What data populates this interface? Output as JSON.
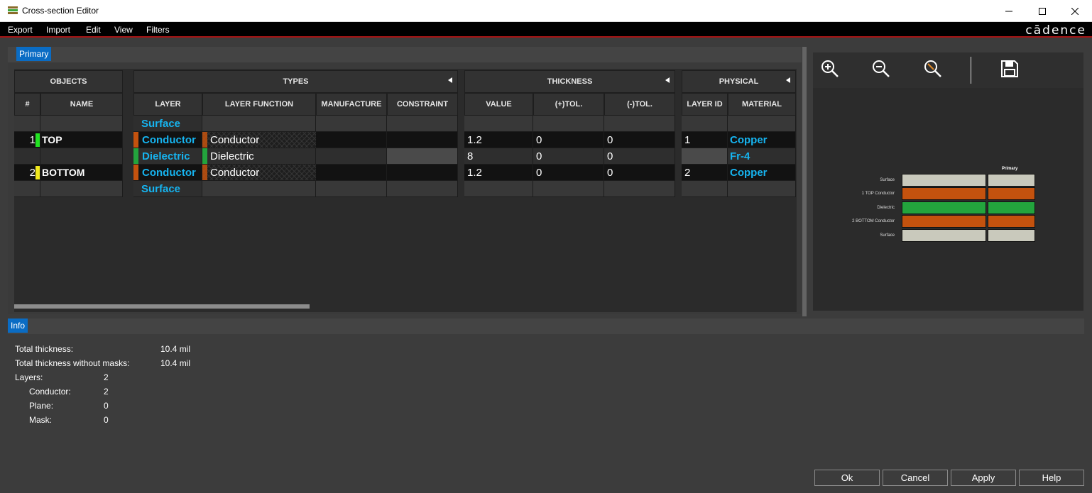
{
  "window": {
    "title": "Cross-section Editor"
  },
  "menu": [
    "Export",
    "Import",
    "Edit",
    "View",
    "Filters"
  ],
  "logo": "cādence",
  "tabs": {
    "primary": "Primary",
    "info": "Info"
  },
  "groups": {
    "objects": "OBJECTS",
    "types": "TYPES",
    "thickness": "THICKNESS",
    "physical": "PHYSICAL"
  },
  "columns": {
    "num": "#",
    "name": "NAME",
    "layer": "LAYER",
    "layer_function": "LAYER FUNCTION",
    "manufacture": "MANUFACTURE",
    "constraint": "CONSTRAINT",
    "value": "VALUE",
    "ptol": "(+)TOL.",
    "ntol": "(-)TOL.",
    "layer_id": "LAYER ID",
    "material": "MATERIAL"
  },
  "rows": [
    {
      "num": "",
      "name": "",
      "layer": "Surface",
      "function": "",
      "value": "",
      "ptol": "",
      "ntol": "",
      "layer_id": "",
      "material": ""
    },
    {
      "num": "1",
      "name": "TOP",
      "name_color": "#22e322",
      "layer": "Conductor",
      "layer_color": "#c4520e",
      "function": "Conductor",
      "value": "1.2",
      "ptol": "0",
      "ntol": "0",
      "layer_id": "1",
      "material": "Copper"
    },
    {
      "num": "",
      "name": "",
      "layer": "Dielectric",
      "layer_color": "#23a43d",
      "function": "Dielectric",
      "value": "8",
      "ptol": "0",
      "ntol": "0",
      "layer_id": "",
      "material": "Fr-4"
    },
    {
      "num": "2",
      "name": "BOTTOM",
      "name_color": "#f0e81e",
      "layer": "Conductor",
      "layer_color": "#c4520e",
      "function": "Conductor",
      "value": "1.2",
      "ptol": "0",
      "ntol": "0",
      "layer_id": "2",
      "material": "Copper"
    },
    {
      "num": "",
      "name": "",
      "layer": "Surface",
      "function": "",
      "value": "",
      "ptol": "",
      "ntol": "",
      "layer_id": "",
      "material": ""
    }
  ],
  "preview": {
    "column_title": "Primary",
    "labels": [
      "Surface",
      "1    TOP Conductor",
      "Dielectric",
      "2    BOTTOM Conductor",
      "Surface"
    ],
    "colors": [
      "#c9c9bc",
      "#c4520e",
      "#23a43d",
      "#c4520e",
      "#c9c9bc"
    ],
    "tools": [
      "zoom-in-icon",
      "zoom-out-icon",
      "zoom-fit-icon",
      "save-icon"
    ]
  },
  "info": {
    "total_thickness_label": "Total thickness:",
    "total_thickness": "10.4 mil",
    "total_no_masks_label": "Total thickness without masks:",
    "total_no_masks": "10.4 mil",
    "layers_label": "Layers:",
    "layers": "2",
    "conductor_label": "Conductor:",
    "conductor": "2",
    "plane_label": "Plane:",
    "plane": "0",
    "mask_label": "Mask:",
    "mask": "0"
  },
  "buttons": {
    "ok": "Ok",
    "cancel": "Cancel",
    "apply": "Apply",
    "help": "Help"
  }
}
